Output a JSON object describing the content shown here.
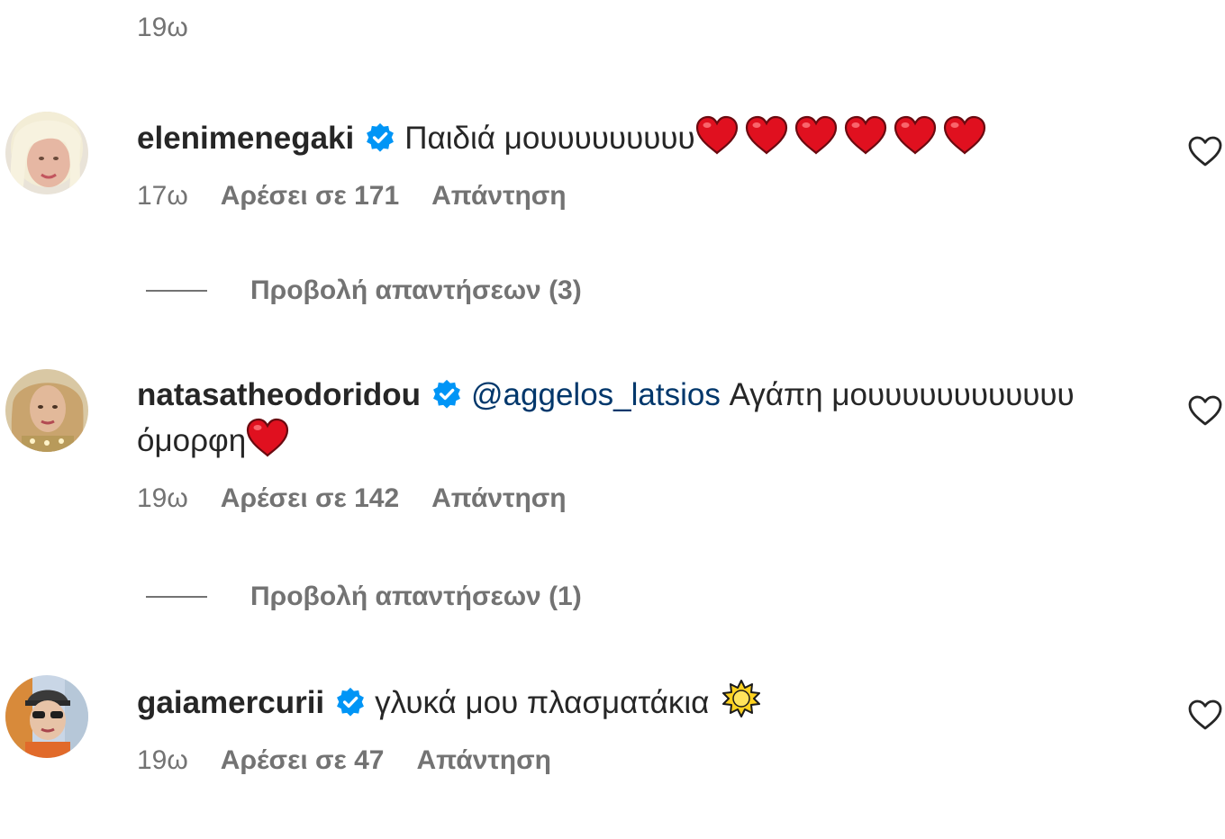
{
  "top_time": "19ω",
  "comments": [
    {
      "username": "elenimenegaki",
      "text_before_mention": "",
      "mention": "",
      "text": "Παιδιά μουυυυυυυυυ",
      "time": "17ω",
      "likes": "Αρέσει σε 171",
      "reply": "Απάντηση",
      "view_replies": "Προβολή απαντήσεων (3)",
      "emoji": "red-heart x6"
    },
    {
      "username": "natasatheodoridou",
      "mention": "@aggelos_latsios",
      "text": " Αγάπη μουυυυυυυυυυυυ όμορφη",
      "time": "19ω",
      "likes": "Αρέσει σε 142",
      "reply": "Απάντηση",
      "view_replies": "Προβολή απαντήσεων (1)",
      "emoji": "red-heart x1"
    },
    {
      "username": "gaiamercurii",
      "text": "γλυκά μου πλασματάκια",
      "time": "19ω",
      "likes": "Αρέσει σε 47",
      "reply": "Απάντηση",
      "emoji": "sun-emoji"
    }
  ],
  "colors": {
    "text": "#262626",
    "secondary": "#737373",
    "mention": "#00376b",
    "verified": "#0095f6",
    "heart": "#e0101f"
  }
}
